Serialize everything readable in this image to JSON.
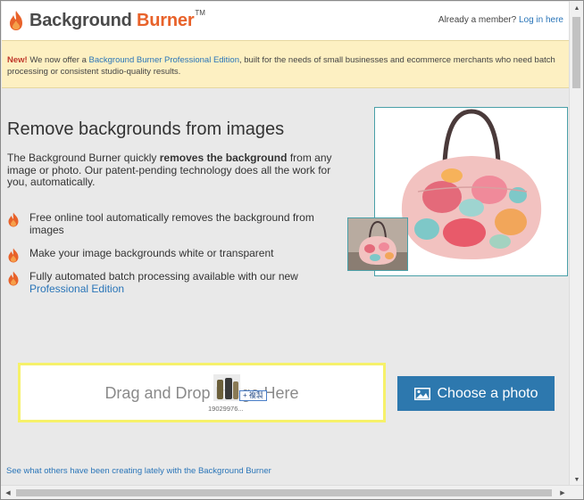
{
  "header": {
    "logo_prefix": "Background ",
    "logo_accent": "Burner",
    "logo_tm": "TM",
    "member_text": "Already a member?",
    "login_link": "Log in here"
  },
  "notice": {
    "new_label": "New!",
    "text_before": " We now offer a ",
    "link": "Background Burner Professional Edition",
    "text_after": ", built for the needs of small businesses and ecommerce merchants who need batch processing or consistent studio-quality results."
  },
  "hero": {
    "title": "Remove backgrounds from images",
    "desc_before": "The Background Burner quickly ",
    "desc_bold": "removes the background",
    "desc_after": " from any image or photo. Our patent-pending technology does all the work for you, automatically."
  },
  "features": [
    {
      "text": "Free online tool automatically removes the background from images"
    },
    {
      "text": "Make your image backgrounds white or transparent"
    },
    {
      "text": "Fully automated batch processing available with our new ",
      "link": "Professional Edition"
    }
  ],
  "dropzone": {
    "label": "Drag and Drop Image Here",
    "copy_badge": "+ 複製",
    "ghost_filename": "19029976..."
  },
  "choose_button": {
    "label": "Choose a photo"
  },
  "others_link": "See what others have been creating lately with the Background Burner",
  "colors": {
    "accent_orange": "#e8622a",
    "link_blue": "#2a75b8",
    "button_blue": "#2d78ae",
    "notice_bg": "#fdf0c2",
    "dropzone_border": "#f6f16a",
    "photo_border": "#4aa0a8"
  },
  "icons": [
    "flame-logo-icon",
    "flame-bullet-icon",
    "picture-icon",
    "scroll-up-icon",
    "scroll-down-icon",
    "scroll-left-icon",
    "scroll-right-icon"
  ]
}
